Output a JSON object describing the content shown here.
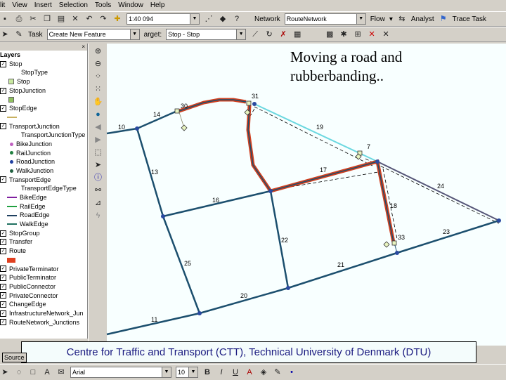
{
  "menu": [
    "lit",
    "View",
    "Insert",
    "Selection",
    "Tools",
    "Window",
    "Help"
  ],
  "toolbar1": {
    "scale": "1:40 094",
    "network_label": "Network",
    "network_value": "RouteNetwork",
    "flow": "Flow",
    "analyst": "Analyst",
    "trace_task": "Trace Task"
  },
  "toolbar2": {
    "task_label": "Task",
    "task_value": "Create New Feature",
    "target_label": "arget:",
    "target_value": "Stop - Stop"
  },
  "toc": {
    "title": "Layers",
    "items": [
      {
        "label": "Stop",
        "type": "layer"
      },
      {
        "label": "StopType",
        "type": "sub"
      },
      {
        "label": "Stop",
        "type": "sym",
        "color": "#c8e8a0"
      },
      {
        "label": "StopJunction",
        "type": "layer"
      },
      {
        "label": "",
        "type": "sym",
        "color": "#90c060"
      },
      {
        "label": "StopEdge",
        "type": "layer"
      },
      {
        "label": "",
        "type": "line",
        "color": "#c8b060"
      },
      {
        "label": "TransportJunction",
        "type": "layer"
      },
      {
        "label": "TransportJunctionType",
        "type": "sub"
      },
      {
        "label": "BikeJunction",
        "type": "dot",
        "color": "#c060c0"
      },
      {
        "label": "RailJunction",
        "type": "dot",
        "color": "#208040"
      },
      {
        "label": "RoadJunction",
        "type": "dot",
        "color": "#2040a0"
      },
      {
        "label": "WalkJunction",
        "type": "dot",
        "color": "#206040"
      },
      {
        "label": "TransportEdge",
        "type": "layer"
      },
      {
        "label": "TransportEdgeType",
        "type": "sub"
      },
      {
        "label": "BikeEdge",
        "type": "line",
        "color": "#8020a0"
      },
      {
        "label": "RailEdge",
        "type": "line",
        "color": "#20a040"
      },
      {
        "label": "RoadEdge",
        "type": "line",
        "color": "#204060"
      },
      {
        "label": "WalkEdge",
        "type": "line",
        "color": "#207060"
      },
      {
        "label": "StopGroup",
        "type": "layer"
      },
      {
        "label": "Transfer",
        "type": "layer"
      },
      {
        "label": "Route",
        "type": "layer"
      },
      {
        "label": "",
        "type": "box",
        "color": "#e04020"
      },
      {
        "label": "PrivateTerminator",
        "type": "layer"
      },
      {
        "label": "PublicTerminator",
        "type": "layer"
      },
      {
        "label": "PublicConnector",
        "type": "layer"
      },
      {
        "label": "PrivateConnector",
        "type": "layer"
      },
      {
        "label": "ChangeEdge",
        "type": "layer"
      },
      {
        "label": "InfrastructureNetwork_Jun",
        "type": "layer"
      },
      {
        "label": "RouteNetwork_Junctions",
        "type": "layer"
      }
    ],
    "source_tab": "Source"
  },
  "map": {
    "note_line1": "Moving a road and",
    "note_line2": "rubberbanding..",
    "labels": [
      "10",
      "14",
      "30",
      "31",
      "13",
      "16",
      "17",
      "18",
      "24",
      "23",
      "22",
      "21",
      "25",
      "20",
      "11",
      "19",
      "7",
      "33"
    ]
  },
  "caption": "Centre for Traffic and Transport (CTT), Technical University of Denmark (DTU)",
  "drawing": {
    "font": "Arial",
    "size": "10"
  }
}
